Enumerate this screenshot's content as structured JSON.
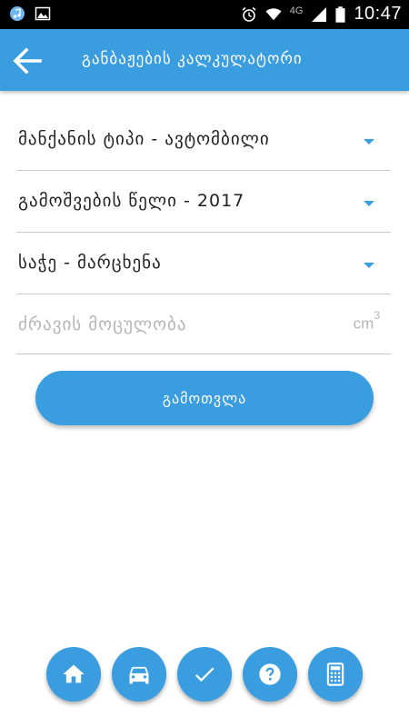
{
  "status_bar": {
    "network": "4G",
    "time": "10:47"
  },
  "app_bar": {
    "title": "განბაჟების კალკულატორი"
  },
  "form": {
    "vehicle_type": "მანქანის ტიპი - ავტომბილი",
    "year": "გამოშვების წელი - 2017",
    "steering": "საჭე - მარცხენა",
    "engine_volume_placeholder": "ძრავის მოცულობა",
    "engine_volume_value": "",
    "unit_base": "cm",
    "unit_exp": "3"
  },
  "actions": {
    "calculate_label": "გამოთვლა"
  },
  "bottom_nav": {
    "items": [
      "home-icon",
      "car-icon",
      "check-icon",
      "help-icon",
      "calculator-icon"
    ]
  },
  "colors": {
    "primary": "#3a9de0",
    "status_bar": "#000000",
    "divider": "#c8c8c8",
    "placeholder": "#b5b5b5"
  }
}
